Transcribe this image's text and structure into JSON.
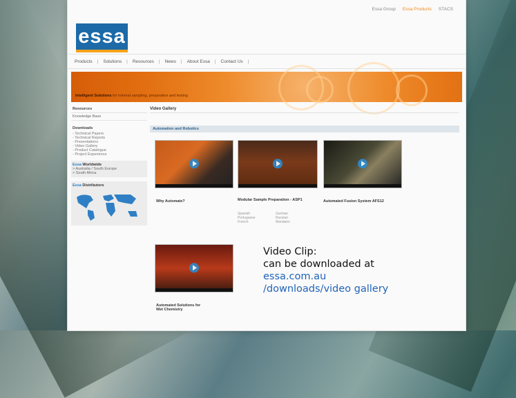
{
  "topnav": {
    "items": [
      "Essa Group",
      "Essa Products",
      "STACS"
    ]
  },
  "logo": "essa",
  "mainnav": {
    "items": [
      "Products",
      "Solutions",
      "Resources",
      "News",
      "About Essa",
      "Contact Us"
    ]
  },
  "banner": {
    "tagline_bold": "Intelligent Solutions",
    "tagline_rest": " for mineral sampling, preparation and testing"
  },
  "sidebar": {
    "head": "Resources",
    "item1": "Knowledge Base",
    "section": "Downloads",
    "list": [
      "- Technical Papers",
      "- Technical Reports",
      "- Presentations",
      "- Video Gallery",
      "- Product Catalogue",
      "- Project Experience"
    ],
    "worldwide_brand": "Essa",
    "worldwide": " Worldwide",
    "worldwide_list": [
      "> Australia / South Europe",
      "> South Africa"
    ],
    "distributors_brand": "Essa",
    "distributors": " Distributors"
  },
  "content": {
    "crumb": "Video Gallery",
    "section": "Automation and Robotics",
    "videos": [
      {
        "title": "Why Automate?"
      },
      {
        "title": "Modular Sample Preparation - ASP1"
      },
      {
        "title": "Automated Fusion System AFS12"
      },
      {
        "title": "Automated Solutions for Wet Chemistry"
      }
    ],
    "langs_col1": [
      "Spanish",
      "Portuguese",
      "French"
    ],
    "langs_col2": [
      "German",
      "Russian",
      "Mandarin"
    ]
  },
  "annotation": {
    "line1": "Video Clip:",
    "line2": "can be downloaded at",
    "line3": "essa.com.au",
    "line4": "/downloads/video gallery"
  },
  "colors": {
    "brand_blue": "#1c6aa8",
    "orange": "#ee8a2a",
    "link": "#1f63b8"
  }
}
